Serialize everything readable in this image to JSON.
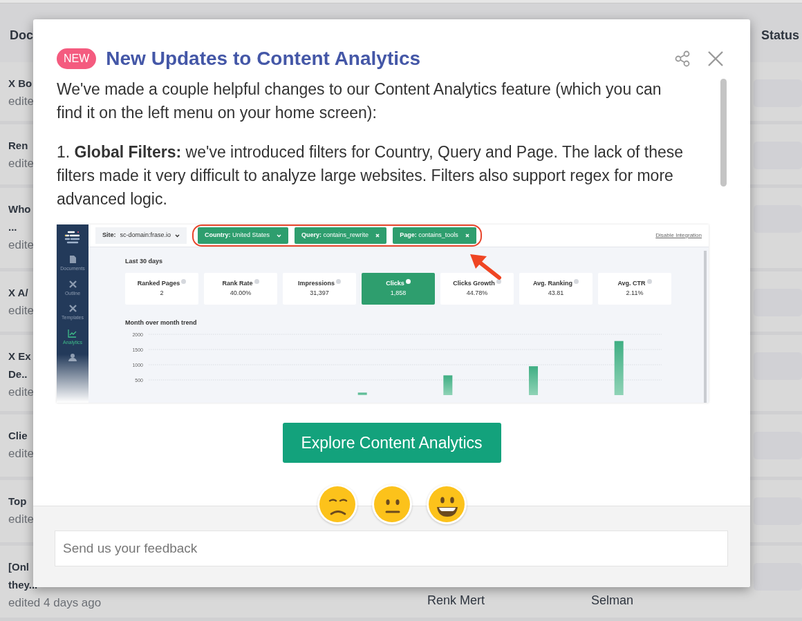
{
  "background_table": {
    "columns": [
      {
        "label": "Doc"
      },
      {
        "label": "Status"
      }
    ],
    "rows": [
      {
        "title_lines": [
          "X Bo"
        ],
        "meta": "edite"
      },
      {
        "title_lines": [
          "Ren"
        ],
        "meta": "edite"
      },
      {
        "title_lines": [
          "Who",
          "..."
        ],
        "meta": "edite"
      },
      {
        "title_lines": [
          "X A/"
        ],
        "meta": "edite"
      },
      {
        "title_lines": [
          "X Ex",
          "De.."
        ],
        "meta": "edite"
      },
      {
        "title_lines": [
          "Clie"
        ],
        "meta": "edite"
      },
      {
        "title_lines": [
          "Top"
        ],
        "meta": "edite"
      },
      {
        "title_lines": [
          "[Onl",
          "they..."
        ],
        "meta": "edited 4 days ago",
        "column_3": "Renk Mert",
        "column_4": "Selman"
      }
    ]
  },
  "modal": {
    "badge": "NEW",
    "title": "New Updates to Content Analytics",
    "paragraphs": [
      "We've made a couple helpful changes to our Content Analytics feature (which you can find it on the left menu on your home screen):",
      "1. **Global Filters:** we've introduced filters for Country, Query and Page. The lack of these filters made it very difficult to analyze large websites. Filters also support regex for more advanced logic."
    ],
    "screenshot": {
      "sidebar": [
        {
          "label": "Documents",
          "kind": "document",
          "selected": false
        },
        {
          "label": "Outline",
          "kind": "tools",
          "selected": false
        },
        {
          "label": "Templates",
          "kind": "tools",
          "selected": false
        },
        {
          "label": "Analytics",
          "kind": "chart",
          "selected": true
        }
      ],
      "site_select": {
        "key": "Site:",
        "value": "sc-domain:frase.io"
      },
      "filters": [
        {
          "key": "Country:",
          "value": "United States",
          "kind": "dropdown"
        },
        {
          "key": "Query:",
          "value": "contains_rewrite",
          "kind": "removable"
        },
        {
          "key": "Page:",
          "value": "contains_tools",
          "kind": "removable"
        }
      ],
      "link": "Disable Integration",
      "period": "Last 30 days",
      "stats": [
        {
          "label": "Ranked Pages",
          "value": "2",
          "selected": false
        },
        {
          "label": "Rank Rate",
          "value": "40.00%",
          "selected": false
        },
        {
          "label": "Impressions",
          "value": "31,397",
          "selected": false
        },
        {
          "label": "Clicks",
          "value": "1,858",
          "selected": true
        },
        {
          "label": "Clicks Growth",
          "value": "44.78%",
          "selected": false
        },
        {
          "label": "Avg. Ranking",
          "value": "43.81",
          "selected": false
        },
        {
          "label": "Avg. CTR",
          "value": "2.11%",
          "selected": false
        }
      ],
      "chart_title": "Month over month trend",
      "chart_data": {
        "type": "bar",
        "grid": true,
        "values": [
          null,
          null,
          80,
          650,
          950,
          1780
        ],
        "ylim": [
          0,
          2000
        ],
        "yticks": [
          500,
          1000,
          1500,
          2000
        ]
      }
    },
    "button": "Explore Content Analytics",
    "reactions": [
      {
        "kind": "sad"
      },
      {
        "kind": "neutral"
      },
      {
        "kind": "happy"
      }
    ],
    "feedback": {
      "placeholder": "Send us your feedback"
    }
  }
}
